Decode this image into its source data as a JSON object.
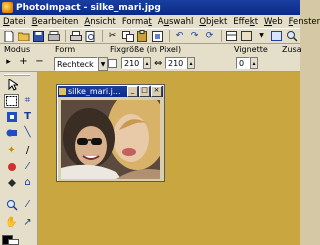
{
  "window": {
    "title": "PhotoImpact - silke_mari.jpg"
  },
  "menu": [
    {
      "label": "Datei",
      "ul": "D",
      "rest": "atei"
    },
    {
      "label": "Bearbeiten",
      "ul": "B",
      "rest": "earbeiten"
    },
    {
      "label": "Ansicht",
      "ul": "A",
      "rest": "nsicht"
    },
    {
      "label": "Format",
      "ul": "",
      "pre": "Forma",
      "mid": "t",
      "rest": ""
    },
    {
      "label": "Auswahl",
      "ul": "",
      "pre": "A",
      "mid": "u",
      "rest": "swahl"
    },
    {
      "label": "Objekt",
      "ul": "O",
      "rest": "bjekt"
    },
    {
      "label": "Effekt",
      "ul": "",
      "pre": "Effe",
      "mid": "k",
      "rest": "t"
    },
    {
      "label": "Web",
      "ul": "W",
      "rest": "eb"
    },
    {
      "label": "Fenster",
      "ul": "F",
      "rest": "enster"
    }
  ],
  "options": {
    "modus_label": "Modus",
    "form_label": "Form",
    "form_value": "Rechteck",
    "size_label": "Fixgröße (in Pixel)",
    "width_value": "210",
    "height_value": "210",
    "vignette_label": "Vignette",
    "vignette_value": "0",
    "cut_label": "Zusa"
  },
  "document": {
    "title": "silke_mari.j...",
    "min": "_",
    "max": "□",
    "close": "×"
  }
}
